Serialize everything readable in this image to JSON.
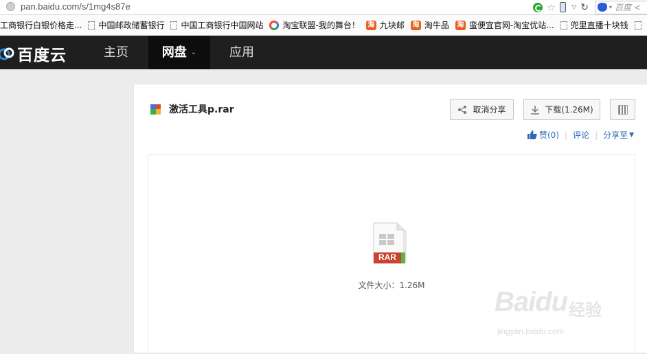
{
  "browser": {
    "url": "pan.baidu.com/s/1mg4s87e",
    "search_placeholder": "百度 <",
    "icons": [
      "globe-icon",
      "go-icon",
      "star-icon",
      "phone-icon",
      "dropdown-icon",
      "refresh-icon",
      "paw-icon"
    ]
  },
  "bookmarks": [
    {
      "label": "工商银行白银价格走...",
      "icon": "none"
    },
    {
      "label": "中国邮政储蓄银行",
      "icon": "page"
    },
    {
      "label": "中国工商银行中国网站",
      "icon": "page"
    },
    {
      "label": "淘宝联盟-我的舞台！",
      "icon": "union"
    },
    {
      "label": "九块邮",
      "icon": "taobao"
    },
    {
      "label": "淘牛品",
      "icon": "taobao"
    },
    {
      "label": "蛮便宜官网-淘宝优站...",
      "icon": "taobao"
    },
    {
      "label": "兜里直播十块钱",
      "icon": "page"
    },
    {
      "label": "",
      "icon": "page"
    }
  ],
  "nav": {
    "logo_text": "百度云",
    "items": [
      "主页",
      "网盘",
      "应用"
    ]
  },
  "file": {
    "name": "激活工具p.rar",
    "unshare_label": "取消分享",
    "download_label": "下载(1.26M)",
    "like_label": "赞(0)",
    "comment_label": "评论",
    "share_to_label": "分享至",
    "type_badge": "RAR",
    "size_text": "文件大小：1.26M"
  },
  "watermark": {
    "brand": "Baidu",
    "brand_cn": "经验",
    "url": "jingyan.baidu.com"
  },
  "colors": {
    "nav_bg": "#1f1f1f",
    "nav_active_bg": "#0d0d0d",
    "link": "#2f68b8",
    "rar_badge": "#c9432f"
  }
}
